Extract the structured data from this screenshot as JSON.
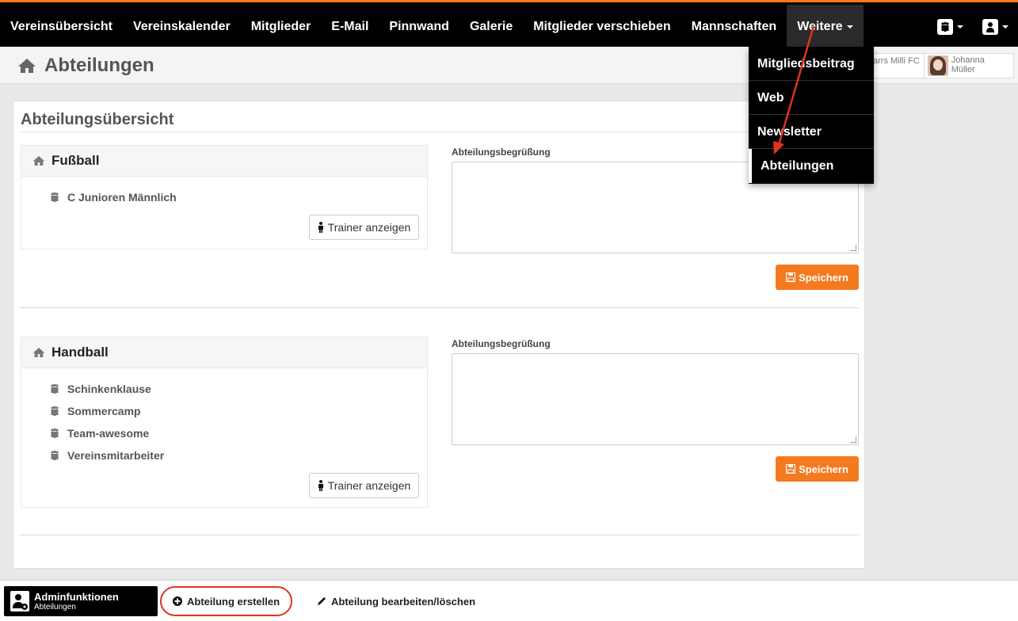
{
  "nav": {
    "items": [
      {
        "label": "Vereinsübersicht"
      },
      {
        "label": "Vereinskalender"
      },
      {
        "label": "Mitglieder"
      },
      {
        "label": "E-Mail"
      },
      {
        "label": "Pinnwand"
      },
      {
        "label": "Galerie"
      },
      {
        "label": "Mitglieder verschieben"
      },
      {
        "label": "Mannschaften"
      }
    ],
    "more_label": "Weitere"
  },
  "dropdown": {
    "items": [
      {
        "label": "Mitgliedsbeitrag"
      },
      {
        "label": "Web"
      },
      {
        "label": "Newsletter"
      },
      {
        "label": "Abteilungen"
      }
    ]
  },
  "header": {
    "title": "Abteilungen",
    "club": "arrs Milli FC",
    "user": "Johanna Müller"
  },
  "panel": {
    "title": "Abteilungsübersicht",
    "greeting_label": "Abteilungsbegrüßung",
    "trainer_button": "Trainer anzeigen",
    "save_button": "Speichern",
    "departments": [
      {
        "name": "Fußball",
        "teams": [
          "C Junioren Männlich"
        ]
      },
      {
        "name": "Handball",
        "teams": [
          "Schinkenklause",
          "Sommercamp",
          "Team-awesome",
          "Vereinsmitarbeiter"
        ]
      }
    ]
  },
  "bottombar": {
    "admin_title": "Adminfunktionen",
    "admin_subtitle": "Abteilungen",
    "create_label": "Abteilung erstellen",
    "edit_label": "Abteilung bearbeiten/löschen"
  },
  "colors": {
    "accent": "#f47a20",
    "annotation": "#e2331d"
  },
  "icons": [
    "home-icon",
    "group-icon",
    "person-icon",
    "floppy-disk-icon",
    "plus-circle-icon",
    "pencil-icon",
    "admin-gear-icon",
    "user-icon"
  ]
}
